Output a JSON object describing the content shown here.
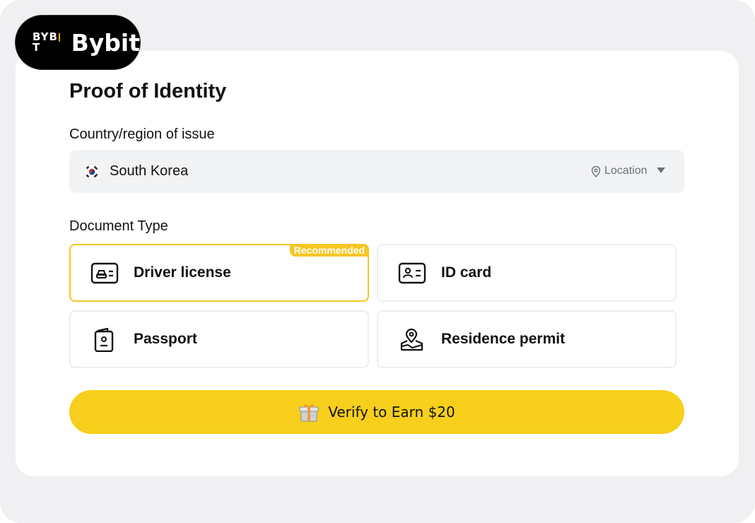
{
  "brand": {
    "mark": "BYBIT",
    "name": "Bybit"
  },
  "page": {
    "title": "Proof of Identity"
  },
  "country": {
    "label": "Country/region of issue",
    "value": "South Korea",
    "flag_icon": "south-korea-flag-icon",
    "location_label": "Location"
  },
  "document": {
    "label": "Document Type",
    "options": [
      {
        "label": "Driver license",
        "icon": "driver-license-icon",
        "selected": true,
        "badge": "Recommended"
      },
      {
        "label": "ID card",
        "icon": "id-card-icon",
        "selected": false
      },
      {
        "label": "Passport",
        "icon": "passport-icon",
        "selected": false
      },
      {
        "label": "Residence permit",
        "icon": "residence-permit-icon",
        "selected": false
      }
    ]
  },
  "cta": {
    "label": "Verify to Earn $20",
    "icon": "gift-icon"
  },
  "colors": {
    "accent": "#f7cf1c",
    "selected_border": "#f7c623",
    "text": "#121214",
    "muted": "#6c6f78",
    "background": "#f0f0f3"
  }
}
